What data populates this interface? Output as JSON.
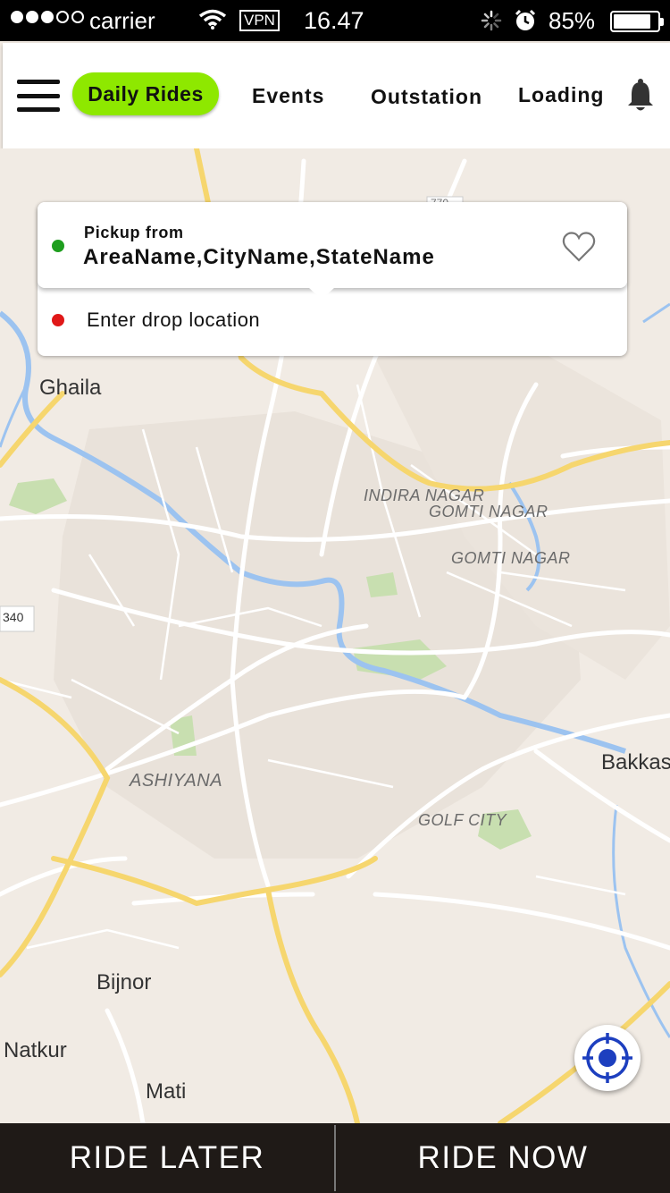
{
  "status_bar": {
    "carrier": "carrier",
    "vpn": "VPN",
    "time": "16.47",
    "battery": "85%",
    "battery_level": 0.85
  },
  "nav": {
    "menu_icon": "hamburger-menu-icon",
    "tabs": [
      {
        "label": "Daily Rides",
        "active": true
      },
      {
        "label": "Events",
        "active": false
      },
      {
        "label": "Outstation",
        "active": false
      },
      {
        "label": "Loading",
        "active": false
      }
    ],
    "notification_icon": "bell-icon",
    "active_color": "#8ee800"
  },
  "location_card": {
    "pickup_label": "Pickup from",
    "pickup_value": "AreaName,CityName,StateName",
    "drop_placeholder": "Enter drop location",
    "pickup_dot_color": "#1e9e1e",
    "drop_dot_color": "#e01818",
    "favorite_icon": "heart-icon"
  },
  "map": {
    "labels": [
      "Ghaila",
      "INDIRA NAGAR",
      "GOMTI NAGAR",
      "GOMTI NAGAR",
      "340",
      "Bakkas",
      "ASHIYANA",
      "GOLF CITY",
      "Bijnor",
      "Natkur",
      "Mati",
      "770"
    ],
    "locate_icon": "gps-locate-icon"
  },
  "bottom_bar": {
    "ride_later": "RIDE LATER",
    "ride_now": "RIDE NOW"
  }
}
